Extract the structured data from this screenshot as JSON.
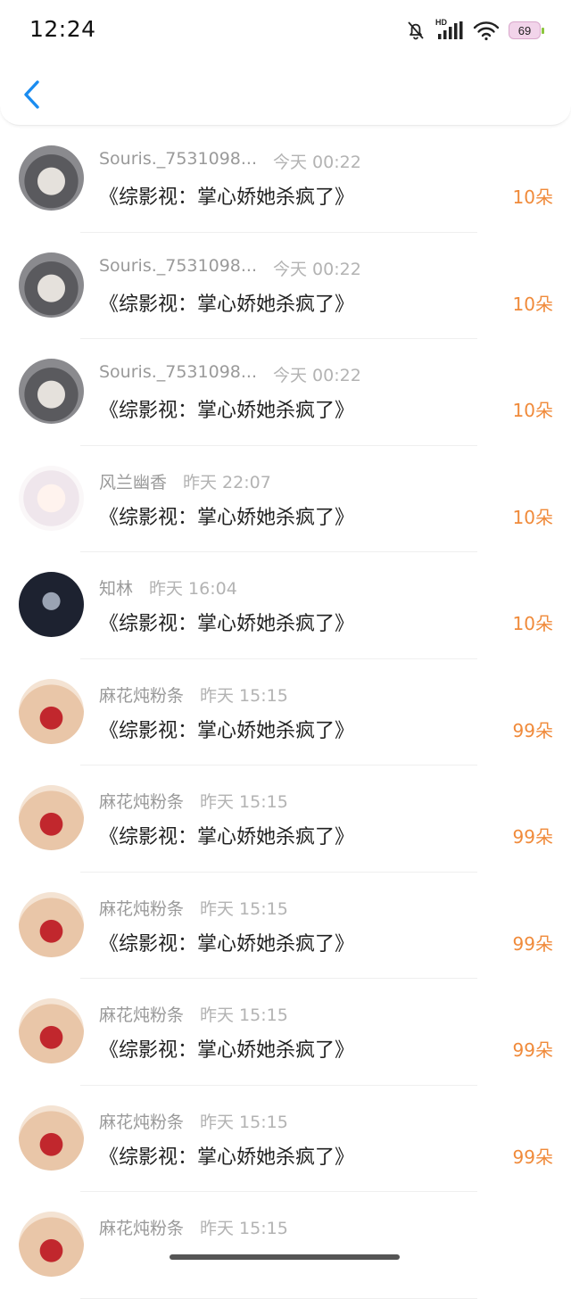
{
  "status_bar": {
    "time": "12:24",
    "network_label": "HD",
    "battery": "69"
  },
  "colors": {
    "amount": "#f08a3a",
    "back_arrow": "#1a8cf0"
  },
  "rows": [
    {
      "name": "Souris._7531098...",
      "time": "今天 00:22",
      "title": "《综影视：掌心娇她杀疯了》",
      "amount": "10朵",
      "avatar": "dark"
    },
    {
      "name": "Souris._7531098...",
      "time": "今天 00:22",
      "title": "《综影视：掌心娇她杀疯了》",
      "amount": "10朵",
      "avatar": "dark"
    },
    {
      "name": "Souris._7531098...",
      "time": "今天 00:22",
      "title": "《综影视：掌心娇她杀疯了》",
      "amount": "10朵",
      "avatar": "dark"
    },
    {
      "name": "风兰幽香",
      "time": "昨天 22:07",
      "title": "《综影视：掌心娇她杀疯了》",
      "amount": "10朵",
      "avatar": "girl"
    },
    {
      "name": "知林",
      "time": "昨天 16:04",
      "title": "《综影视：掌心娇她杀疯了》",
      "amount": "10朵",
      "avatar": "man"
    },
    {
      "name": "麻花炖粉条",
      "time": "昨天 15:15",
      "title": "《综影视：掌心娇她杀疯了》",
      "amount": "99朵",
      "avatar": "red"
    },
    {
      "name": "麻花炖粉条",
      "time": "昨天 15:15",
      "title": "《综影视：掌心娇她杀疯了》",
      "amount": "99朵",
      "avatar": "red"
    },
    {
      "name": "麻花炖粉条",
      "time": "昨天 15:15",
      "title": "《综影视：掌心娇她杀疯了》",
      "amount": "99朵",
      "avatar": "red"
    },
    {
      "name": "麻花炖粉条",
      "time": "昨天 15:15",
      "title": "《综影视：掌心娇她杀疯了》",
      "amount": "99朵",
      "avatar": "red"
    },
    {
      "name": "麻花炖粉条",
      "time": "昨天 15:15",
      "title": "《综影视：掌心娇她杀疯了》",
      "amount": "99朵",
      "avatar": "red"
    },
    {
      "name": "麻花炖粉条",
      "time": "昨天 15:15",
      "title": "",
      "amount": "",
      "avatar": "red"
    }
  ]
}
